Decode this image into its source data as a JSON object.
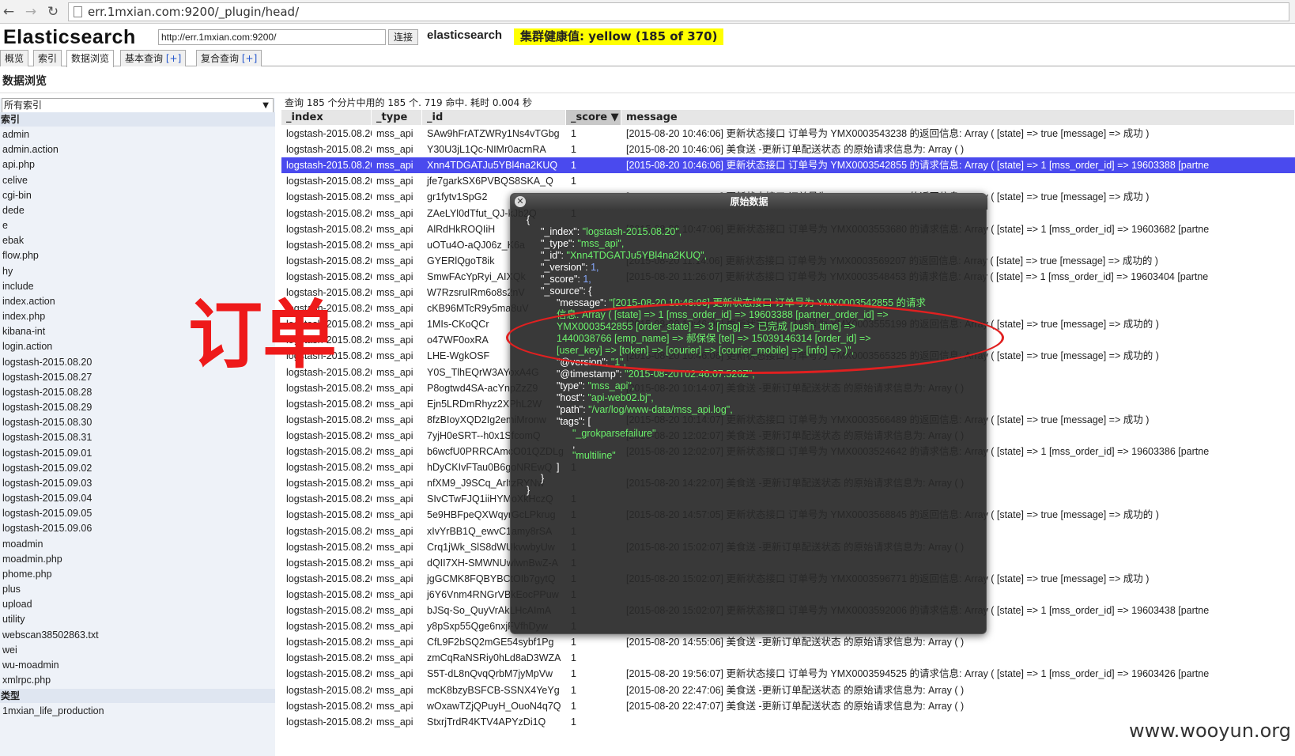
{
  "browser": {
    "url": "err.1mxian.com:9200/_plugin/head/",
    "back_icon": "back-arrow-icon",
    "forward_icon": "forward-arrow-icon",
    "reload_icon": "reload-icon"
  },
  "header": {
    "title": "Elasticsearch",
    "connect_url": "http://err.1mxian.com:9200/",
    "connect_label": "连接",
    "cluster_name": "elasticsearch",
    "health": "集群健康值: yellow (185 of 370)",
    "health_color": "#ffff00"
  },
  "tabs": [
    {
      "label": "概览",
      "plus": ""
    },
    {
      "label": "索引",
      "plus": ""
    },
    {
      "label": "数据浏览",
      "plus": ""
    },
    {
      "label": "基本查询",
      "plus": "[+]"
    },
    {
      "label": "复合查询",
      "plus": "[+]"
    }
  ],
  "section_title": "数据浏览",
  "sidebar": {
    "select_value": "所有索引",
    "index_header": "索引",
    "indices": [
      "admin",
      "admin.action",
      "api.php",
      "celive",
      "cgi-bin",
      "dede",
      "e",
      "ebak",
      "flow.php",
      "hy",
      "include",
      "index.action",
      "index.php",
      "kibana-int",
      "login.action",
      "logstash-2015.08.20",
      "logstash-2015.08.27",
      "logstash-2015.08.28",
      "logstash-2015.08.29",
      "logstash-2015.08.30",
      "logstash-2015.08.31",
      "logstash-2015.09.01",
      "logstash-2015.09.02",
      "logstash-2015.09.03",
      "logstash-2015.09.04",
      "logstash-2015.09.05",
      "logstash-2015.09.06",
      "moadmin",
      "moadmin.php",
      "phome.php",
      "plus",
      "upload",
      "utility",
      "webscan38502863.txt",
      "wei",
      "wu-moadmin",
      "xmlrpc.php"
    ],
    "type_header": "类型",
    "types": [
      "1mxian_life_production"
    ]
  },
  "query_info": "查询 185 个分片中用的 185 个. 719 命中. 耗时 0.004 秒",
  "table": {
    "columns": [
      "_index",
      "_type",
      "_id",
      "_score ▼",
      "message"
    ],
    "rows": [
      {
        "index": "logstash-2015.08.20",
        "type": "mss_api",
        "id": "SAw9hFrATZWRy1Ns4vTGbg",
        "score": "1",
        "message": "[2015-08-20 10:46:06] 更新状态接口 订单号为 YMX0003543238 的返回信息: Array ( [state] => true [message] => 成功 )"
      },
      {
        "index": "logstash-2015.08.20",
        "type": "mss_api",
        "id": "Y30U3jL1Qc-NIMr0acrnRA",
        "score": "1",
        "message": "[2015-08-20 10:46:06] 美食送 -更新订单配送状态 的原始请求信息为:   Array ( )"
      },
      {
        "index": "logstash-2015.08.20",
        "type": "mss_api",
        "id": "Xnn4TDGATJu5YBl4na2KUQ",
        "score": "1",
        "message": "[2015-08-20 10:46:06] 更新状态接口 订单号为 YMX0003542855 的请求信息: Array ( [state] => 1 [mss_order_id] => 19603388 [partne"
      },
      {
        "index": "logstash-2015.08.20",
        "type": "mss_api",
        "id": "jfe7garkSX6PVBQS8SKA_Q",
        "score": "1",
        "message": ""
      },
      {
        "index": "logstash-2015.08.20",
        "type": "mss_api",
        "id": "gr1fytv1SpG2",
        "score": "",
        "message": "[2015-08-20 10:46:06] 更新状态接口 订单号为 YMX0003558048 的返回信息: Array ( [state] => true [message] => 成功 )"
      },
      {
        "index": "logstash-2015.08.20",
        "type": "mss_api",
        "id": "ZAeLYl0dTfut_QJ-kJb2Q",
        "score": "1",
        "message": ""
      },
      {
        "index": "logstash-2015.08.20",
        "type": "mss_api",
        "id": "AlRdHkROQIiH",
        "score": "",
        "message": "[2015-08-20 10:47:06] 更新状态接口 订单号为 YMX0003553680 的请求信息: Array ( [state] => 1 [mss_order_id] => 19603682 [partne"
      },
      {
        "index": "logstash-2015.08.20",
        "type": "mss_api",
        "id": "uOTu4O-aQJ06z_K6a",
        "score": "",
        "message": ""
      },
      {
        "index": "logstash-2015.08.20",
        "type": "mss_api",
        "id": "GYERlQgoT8ik",
        "score": "",
        "message": "[2015-08-20 11:14:06] 更新状态接口 订单号为 YMX0003569207 的返回信息: Array ( [state] => true [message] => 成功的 )"
      },
      {
        "index": "logstash-2015.08.20",
        "type": "mss_api",
        "id": "SmwFAcYpRyi_AIXQk",
        "score": "",
        "message": "[2015-08-20 11:26:07] 更新状态接口 订单号为 YMX0003548453 的请求信息: Array ( [state] => 1 [mss_order_id] => 19603404 [partne"
      },
      {
        "index": "logstash-2015.08.20",
        "type": "mss_api",
        "id": "W7RzsruIRm6o8s2nV",
        "score": "",
        "message": ""
      },
      {
        "index": "logstash-2015.08.20",
        "type": "mss_api",
        "id": "cKB96MTcR9y5ma8uV",
        "score": "",
        "message": ""
      },
      {
        "index": "logstash-2015.08.20",
        "type": "mss_api",
        "id": "1MIs-CKoQCr",
        "score": "",
        "message": "[2015-08-20 10:46:06] 更新状态接口 订单号为 YMX0003555199 的返回信息: Array ( [state] => true [message] => 成功的 )"
      },
      {
        "index": "logstash-2015.08.20",
        "type": "mss_api",
        "id": "o47WF0oxRA",
        "score": "",
        "message": ""
      },
      {
        "index": "logstash-2015.08.20",
        "type": "mss_api",
        "id": "LHE-WgkOSF",
        "score": "",
        "message": "[2015-08-20 10:46:06] 更新状态接口 订单号为 YMX0003565325 的返回信息: Array ( [state] => true [message] => 成功的 )"
      },
      {
        "index": "logstash-2015.08.20",
        "type": "mss_api",
        "id": "Y0S_TlhEQrW3AYoxA4G",
        "score": "",
        "message": ""
      },
      {
        "index": "logstash-2015.08.20",
        "type": "mss_api",
        "id": "P8ogtwd4SA-acYnpZzZ9",
        "score": "",
        "message": "[2015-08-20 10:14:07] 美食送 -更新订单配送状态 的原始请求信息为:   Array ( )"
      },
      {
        "index": "logstash-2015.08.20",
        "type": "mss_api",
        "id": "Ejn5LRDmRhyz2XPhL2W",
        "score": "",
        "message": ""
      },
      {
        "index": "logstash-2015.08.20",
        "type": "mss_api",
        "id": "8fzBIoyXQD2Ig2emiMronw",
        "score": "",
        "message": "[2015-08-20 10:14:07] 更新状态接口 订单号为 YMX0003566489 的返回信息: Array ( [state] => true [message] => 成功 )"
      },
      {
        "index": "logstash-2015.08.20",
        "type": "mss_api",
        "id": "7yjH0eSRT--h0x1SfcomQ",
        "score": "",
        "message": "[2015-08-20 12:02:07] 美食送 -更新订单配送状态 的原始请求信息为:   Array ( )"
      },
      {
        "index": "logstash-2015.08.20",
        "type": "mss_api",
        "id": "b6wcfU0PRRCAmcO01QZDLg",
        "score": "",
        "message": "[2015-08-20 12:02:07] 更新状态接口 订单号为 YMX0003524642 的请求信息: Array ( [state] => 1 [mss_order_id] => 19603386 [partne"
      },
      {
        "index": "logstash-2015.08.20",
        "type": "mss_api",
        "id": "hDyCKIvFTau0B6goNREwQ",
        "score": "1",
        "message": ""
      },
      {
        "index": "logstash-2015.08.20",
        "type": "mss_api",
        "id": "nfXM9_J9SCq_ArItzRYNw",
        "score": "",
        "message": "[2015-08-20 14:22:07] 美食送 -更新订单配送状态 的原始请求信息为:   Array ( )"
      },
      {
        "index": "logstash-2015.08.20",
        "type": "mss_api",
        "id": "SIvCTwFJQ1iiHYMoXkHczQ",
        "score": "1",
        "message": ""
      },
      {
        "index": "logstash-2015.08.20",
        "type": "mss_api",
        "id": "5e9HBFpeQXWqyrGcLPkrug",
        "score": "1",
        "message": "[2015-08-20 14:57:05] 更新状态接口 订单号为 YMX0003568845 的返回信息: Array ( [state] => true [message] => 成功的 )"
      },
      {
        "index": "logstash-2015.08.20",
        "type": "mss_api",
        "id": "xIvYrBB1Q_ewvC1amy8rSA",
        "score": "1",
        "message": ""
      },
      {
        "index": "logstash-2015.08.20",
        "type": "mss_api",
        "id": "Crq1jWk_SlS8dWUkvwbyUw",
        "score": "1",
        "message": "[2015-08-20 15:02:07] 美食送 -更新订单配送状态 的原始请求信息为:   Array ( )"
      },
      {
        "index": "logstash-2015.08.20",
        "type": "mss_api",
        "id": "dQII7XH-SMWNUwlwnBwZ-A",
        "score": "1",
        "message": ""
      },
      {
        "index": "logstash-2015.08.20",
        "type": "mss_api",
        "id": "jgGCMK8FQBYBCtOIb7gytQ",
        "score": "1",
        "message": "[2015-08-20 15:02:07] 更新状态接口 订单号为 YMX0003596771 的返回信息: Array ( [state] => true [message] => 成功 )"
      },
      {
        "index": "logstash-2015.08.20",
        "type": "mss_api",
        "id": "j6Y6Vnm4RNGrVBkEocPPuw",
        "score": "1",
        "message": ""
      },
      {
        "index": "logstash-2015.08.20",
        "type": "mss_api",
        "id": "bJSq-So_QuyVrAkLHcAImA",
        "score": "1",
        "message": "[2015-08-20 15:02:07] 更新状态接口 订单号为 YMX0003592006 的请求信息: Array ( [state] => 1 [mss_order_id] => 19603438 [partne"
      },
      {
        "index": "logstash-2015.08.20",
        "type": "mss_api",
        "id": "y8pSxp55Qge6nxjFVfhDyw",
        "score": "1",
        "message": ""
      },
      {
        "index": "logstash-2015.08.20",
        "type": "mss_api",
        "id": "CfL9F2bSQ2mGE54sybf1Pg",
        "score": "1",
        "message": "[2015-08-20 14:55:06] 美食送 -更新订单配送状态 的原始请求信息为:   Array ( )"
      },
      {
        "index": "logstash-2015.08.20",
        "type": "mss_api",
        "id": "zmCqRaNSRiy0hLd8aD3WZA",
        "score": "1",
        "message": ""
      },
      {
        "index": "logstash-2015.08.20",
        "type": "mss_api",
        "id": "S5T-dL8nQvqQrbM7jyMpVw",
        "score": "1",
        "message": "[2015-08-20 19:56:07] 更新状态接口 订单号为 YMX0003594525 的请求信息: Array ( [state] => 1 [mss_order_id] => 19603426 [partne"
      },
      {
        "index": "logstash-2015.08.20",
        "type": "mss_api",
        "id": "mcK8bzyBSFCB-SSNX4YeYg",
        "score": "1",
        "message": "[2015-08-20 22:47:06] 美食送 -更新订单配送状态 的原始请求信息为:   Array ( )"
      },
      {
        "index": "logstash-2015.08.20",
        "type": "mss_api",
        "id": "wOxawTZjQPuyH_OuoN4q7Q",
        "score": "1",
        "message": "[2015-08-20 22:47:07] 美食送 -更新订单配送状态 的原始请求信息为:   Array ( )"
      },
      {
        "index": "logstash-2015.08.20",
        "type": "mss_api",
        "id": "StxrjTrdR4KTV4APYzDi1Q",
        "score": "1",
        "message": ""
      }
    ]
  },
  "popup": {
    "title": "原始数据",
    "close_label": "✕",
    "lines": [
      {
        "indent": 0,
        "k": "",
        "v": "{",
        "c": ""
      },
      {
        "indent": 1,
        "k": "\"_index\": ",
        "v": "\"logstash-2015.08.20\",",
        "c": "str"
      },
      {
        "indent": 1,
        "k": "\"_type\": ",
        "v": "\"mss_api\",",
        "c": "str"
      },
      {
        "indent": 1,
        "k": "\"_id\": ",
        "v": "\"Xnn4TDGATJu5YBl4na2KUQ\",",
        "c": "str"
      },
      {
        "indent": 1,
        "k": "\"_version\": ",
        "v": "1,",
        "c": "num"
      },
      {
        "indent": 1,
        "k": "\"_score\": ",
        "v": "1,",
        "c": "num"
      },
      {
        "indent": 1,
        "k": "\"_source\": {",
        "v": "",
        "c": ""
      },
      {
        "indent": 2,
        "k": "\"message\": ",
        "v": "\"[2015-08-20 10:46:06] 更新状态接口 订单号为 YMX0003542855 的请求",
        "c": "str"
      },
      {
        "indent": 2,
        "k": "",
        "v": "信息: Array ( [state] => 1 [mss_order_id] => 19603388 [partner_order_id] =>",
        "c": "str"
      },
      {
        "indent": 2,
        "k": "",
        "v": "YMX0003542855 [order_state] => 3 [msg] => 已完成 [push_time] =>",
        "c": "str"
      },
      {
        "indent": 2,
        "k": "",
        "v": "1440038766 [emp_name] => 郝保保 [tel] => 15039146314 [order_id] =>",
        "c": "str"
      },
      {
        "indent": 2,
        "k": "",
        "v": "[user_key] => [token] => [courier] => [courier_mobile] => [info] => )\",",
        "c": "str"
      },
      {
        "indent": 2,
        "k": "\"@version\": ",
        "v": "\"1\",",
        "c": "str"
      },
      {
        "indent": 2,
        "k": "\"@timestamp\": ",
        "v": "\"2015-08-20T02:46:07.526Z\",",
        "c": "str"
      },
      {
        "indent": 2,
        "k": "\"type\": ",
        "v": "\"mss_api\",",
        "c": "str"
      },
      {
        "indent": 2,
        "k": "\"host\": ",
        "v": "\"api-web02.bj\",",
        "c": "str"
      },
      {
        "indent": 2,
        "k": "\"path\": ",
        "v": "\"/var/log/www-data/mss_api.log\",",
        "c": "str"
      },
      {
        "indent": 2,
        "k": "\"tags\": [",
        "v": "",
        "c": ""
      },
      {
        "indent": 3,
        "k": "",
        "v": "\"_grokparsefailure\"",
        "c": "str"
      },
      {
        "indent": 3,
        "k": ",",
        "v": "",
        "c": ""
      },
      {
        "indent": 3,
        "k": "",
        "v": "\"multiline\"",
        "c": "str"
      },
      {
        "indent": 2,
        "k": "]",
        "v": "",
        "c": ""
      },
      {
        "indent": 1,
        "k": "}",
        "v": "",
        "c": ""
      },
      {
        "indent": 0,
        "k": "}",
        "v": "",
        "c": ""
      }
    ]
  },
  "annotation": {
    "stamp_text": "订单",
    "stamp_color": "#ee1a1a"
  },
  "watermark": "www.wooyun.org"
}
